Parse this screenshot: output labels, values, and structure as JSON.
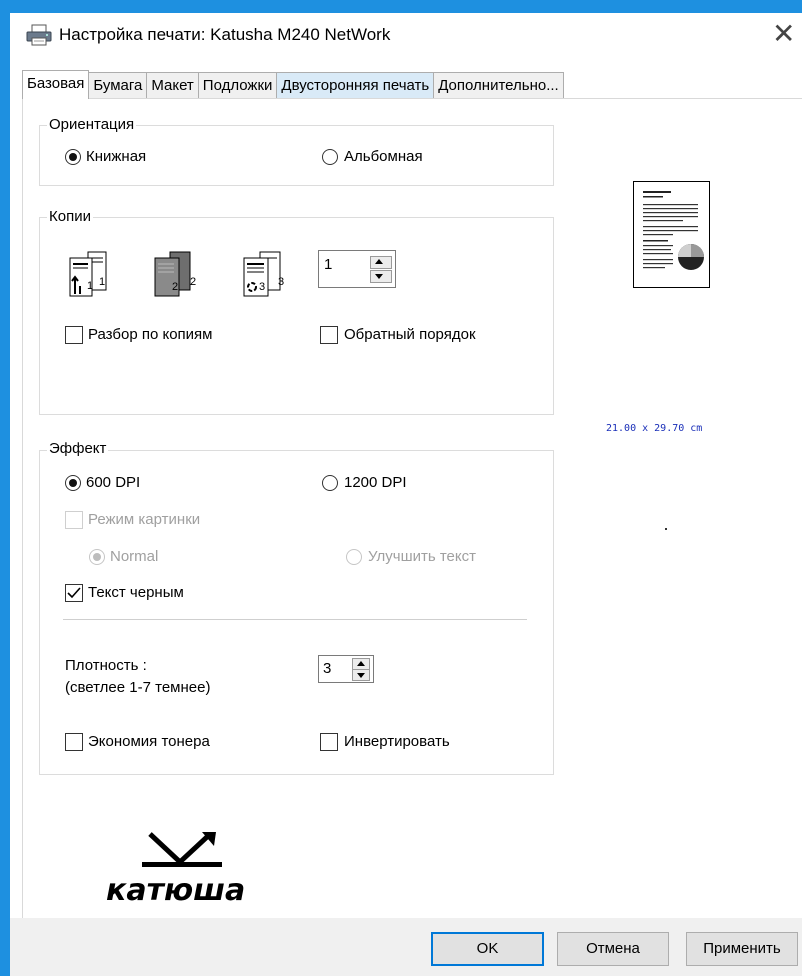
{
  "window": {
    "title": "Настройка печати: Katusha M240 NetWork",
    "close_glyph": "✕"
  },
  "tabs": [
    {
      "label": "Базовая"
    },
    {
      "label": "Бумага"
    },
    {
      "label": "Макет"
    },
    {
      "label": "Подложки"
    },
    {
      "label": "Двусторонняя печать"
    },
    {
      "label": "Дополнительно..."
    }
  ],
  "orientation": {
    "title": "Ориентация",
    "portrait": "Книжная",
    "landscape": "Альбомная",
    "selected": "portrait"
  },
  "copies": {
    "title": "Копии",
    "count": "1",
    "collate_label": "Разбор по копиям",
    "reverse_label": "Обратный порядок",
    "icon_digits": [
      "1",
      "1",
      "2",
      "2",
      "3",
      "3"
    ]
  },
  "effect": {
    "title": "Эффект",
    "dpi600": "600 DPI",
    "dpi1200": "1200 DPI",
    "picture_mode": "Режим картинки",
    "normal": "Normal",
    "improve_text": "Улучшить текст",
    "black_text": "Текст черным",
    "density_label_1": "Плотность :",
    "density_label_2": "(светлее 1-7 темнее)",
    "density_value": "3",
    "toner_save": "Экономия тонера",
    "invert": "Инвертировать"
  },
  "preview": {
    "paper_size": "21.00 x 29.70 cm"
  },
  "logo": {
    "text": "катюша"
  },
  "buttons": {
    "ok": "OK",
    "cancel": "Отмена",
    "apply": "Применить"
  },
  "colors": {
    "accent": "#0078d7",
    "window_border": "#1e90e0",
    "paper_size_text": "#1a2fb8"
  }
}
